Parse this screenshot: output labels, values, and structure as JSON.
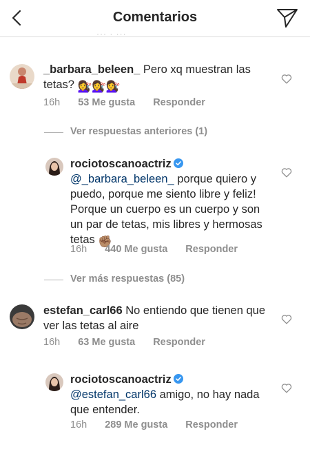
{
  "header": {
    "title": "Comentarios"
  },
  "ghost_text": "···  ·  ···",
  "comments": [
    {
      "username": "_barbara_beleen_",
      "text": " Pero xq muestran las tetas?",
      "emoji": "💇‍♀️💇‍♀️💇‍♀️",
      "time": "16h",
      "likes": "53 Me gusta",
      "reply": "Responder"
    },
    {
      "username": "rociotoscanoactriz",
      "mention": "@_barbara_beleen_",
      "text": " porque quiero y puedo, porque me siento libre y feliz! Porque un cuerpo es un cuerpo y son un par de tetas, mis libres y hermosas tetas ",
      "emoji": "✊🏽",
      "time": "16h",
      "likes": "440 Me gusta",
      "reply": "Responder"
    },
    {
      "username": "estefan_carl66",
      "text": " No entiendo que tienen que ver las tetas al aire",
      "time": "16h",
      "likes": "63 Me gusta",
      "reply": "Responder"
    },
    {
      "username": "rociotoscanoactriz",
      "mention": "@estefan_carl66",
      "text": " amigo, no hay nada que entender.",
      "time": "16h",
      "likes": "289 Me gusta",
      "reply": "Responder"
    }
  ],
  "view_previous": "Ver respuestas anteriores (1)",
  "view_more": "Ver más respuestas (85)",
  "colors": {
    "text": "#262626",
    "meta": "#8e8e8e",
    "mention": "#003569",
    "verified": "#3897f0"
  }
}
